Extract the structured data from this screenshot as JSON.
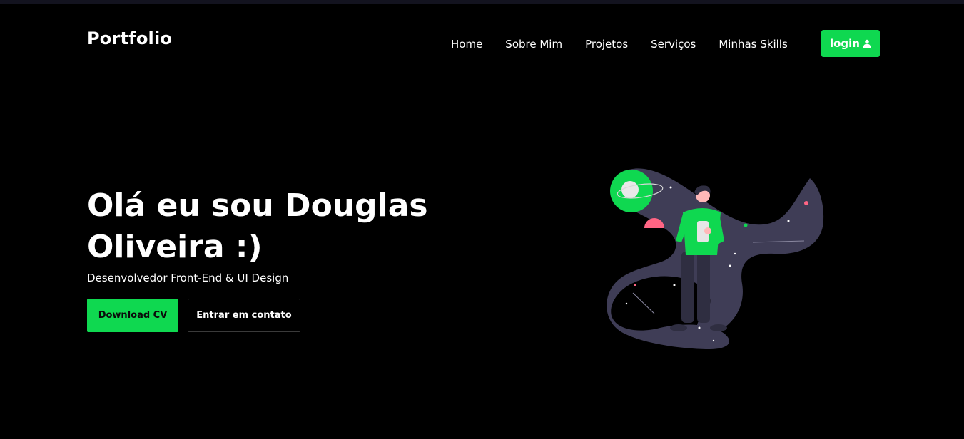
{
  "header": {
    "logo": "Portfolio",
    "nav": [
      "Home",
      "Sobre Mim",
      "Projetos",
      "Serviços",
      "Minhas Skills"
    ],
    "login_label": "login",
    "login_icon": "user-icon"
  },
  "hero": {
    "title_line1": "Olá eu sou Douglas",
    "title_line2": "Oliveira :)",
    "subtitle": "Desenvolvedor Front-End & UI Design",
    "download_label": "Download CV",
    "contact_label": "Entrar em contato",
    "illustration": "space-person-illustration"
  },
  "colors": {
    "accent": "#0fd850",
    "background": "#000000",
    "text": "#ffffff",
    "illustration_purple": "#3f3d56",
    "illustration_pink": "#ff6584"
  }
}
